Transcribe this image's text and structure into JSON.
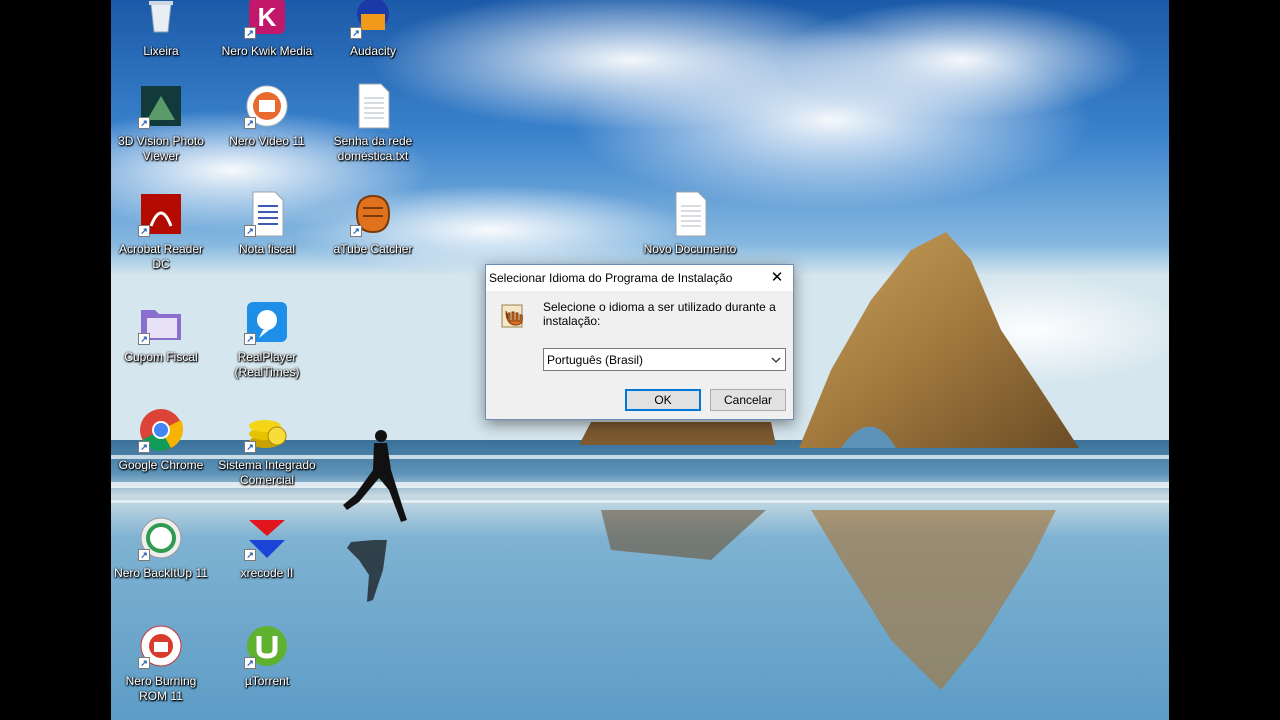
{
  "desktop_icons": [
    {
      "label": "Lixeira",
      "icon": "recycle-bin-icon"
    },
    {
      "label": "Nero Kwik Media",
      "icon": "nero-kwik-media-icon"
    },
    {
      "label": "Audacity",
      "icon": "audacity-icon"
    },
    {
      "label": "3D Vision Photo Viewer",
      "icon": "3d-vision-photo-viewer-icon"
    },
    {
      "label": "Nero Video 11",
      "icon": "nero-video-icon"
    },
    {
      "label": "Senha da rede doméstica.txt",
      "icon": "text-file-icon"
    },
    {
      "label": "Acrobat Reader DC",
      "icon": "acrobat-reader-icon"
    },
    {
      "label": "Nota fiscal",
      "icon": "document-icon"
    },
    {
      "label": "aTube Catcher",
      "icon": "atube-catcher-icon"
    },
    {
      "label": "Novo Documento",
      "icon": "text-file-icon"
    },
    {
      "label": "Cupom Fiscal",
      "icon": "folder-icon"
    },
    {
      "label": "RealPlayer (RealTimes)",
      "icon": "realplayer-icon"
    },
    {
      "label": "Google Chrome",
      "icon": "chrome-icon"
    },
    {
      "label": "Sistema Integrado Comercial",
      "icon": "coins-icon"
    },
    {
      "label": "Nero BackItUp 11",
      "icon": "nero-backitup-icon"
    },
    {
      "label": "xrecode II",
      "icon": "xrecode-icon"
    },
    {
      "label": "Nero Burning ROM 11",
      "icon": "nero-burning-rom-icon"
    },
    {
      "label": "µTorrent",
      "icon": "utorrent-icon"
    }
  ],
  "dialog": {
    "title": "Selecionar Idioma do Programa de Instalação",
    "close_glyph": "✕",
    "prompt": "Selecione o idioma a ser utilizado durante a instalação:",
    "language_selected": "Português (Brasil)",
    "ok_label": "OK",
    "cancel_label": "Cancelar",
    "accent_color": "#0078d7"
  }
}
